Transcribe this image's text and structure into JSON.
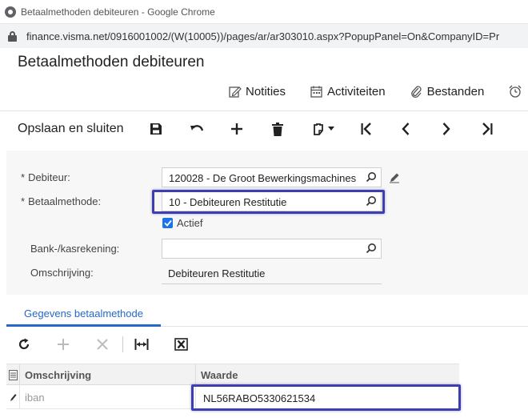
{
  "browser": {
    "tab_title": "Betaalmethoden debiteuren - Google Chrome",
    "url": "finance.visma.net/0916001002/(W(10005))/pages/ar/ar303010.aspx?PopupPanel=On&CompanyID=Pr"
  },
  "page": {
    "title": "Betaalmethoden debiteuren"
  },
  "topnav": {
    "notes": "Notities",
    "activities": "Activiteiten",
    "files": "Bestanden"
  },
  "toolbar": {
    "save_close": "Opslaan en sluiten"
  },
  "form": {
    "customer_label": "Debiteur:",
    "customer_value": "120028 - De Groot Bewerkingsmachines",
    "method_label": "Betaalmethode:",
    "method_value": "10 - Debiteuren Restitutie",
    "active_label": "Actief",
    "active_checked": true,
    "account_label": "Bank-/kasrekening:",
    "account_value": "",
    "description_label": "Omschrijving:",
    "description_value": "Debiteuren Restitutie",
    "required_marker": "*"
  },
  "tabs": {
    "details": "Gegevens betaalmethode"
  },
  "grid": {
    "columns": [
      "Omschrijving",
      "Waarde"
    ],
    "rows": [
      {
        "description": "iban",
        "value": "NL56RABO5330621534"
      }
    ]
  },
  "colors": {
    "highlight": "#3d3fb0",
    "accent": "#2568c8",
    "checkbox": "#1a73e8"
  }
}
